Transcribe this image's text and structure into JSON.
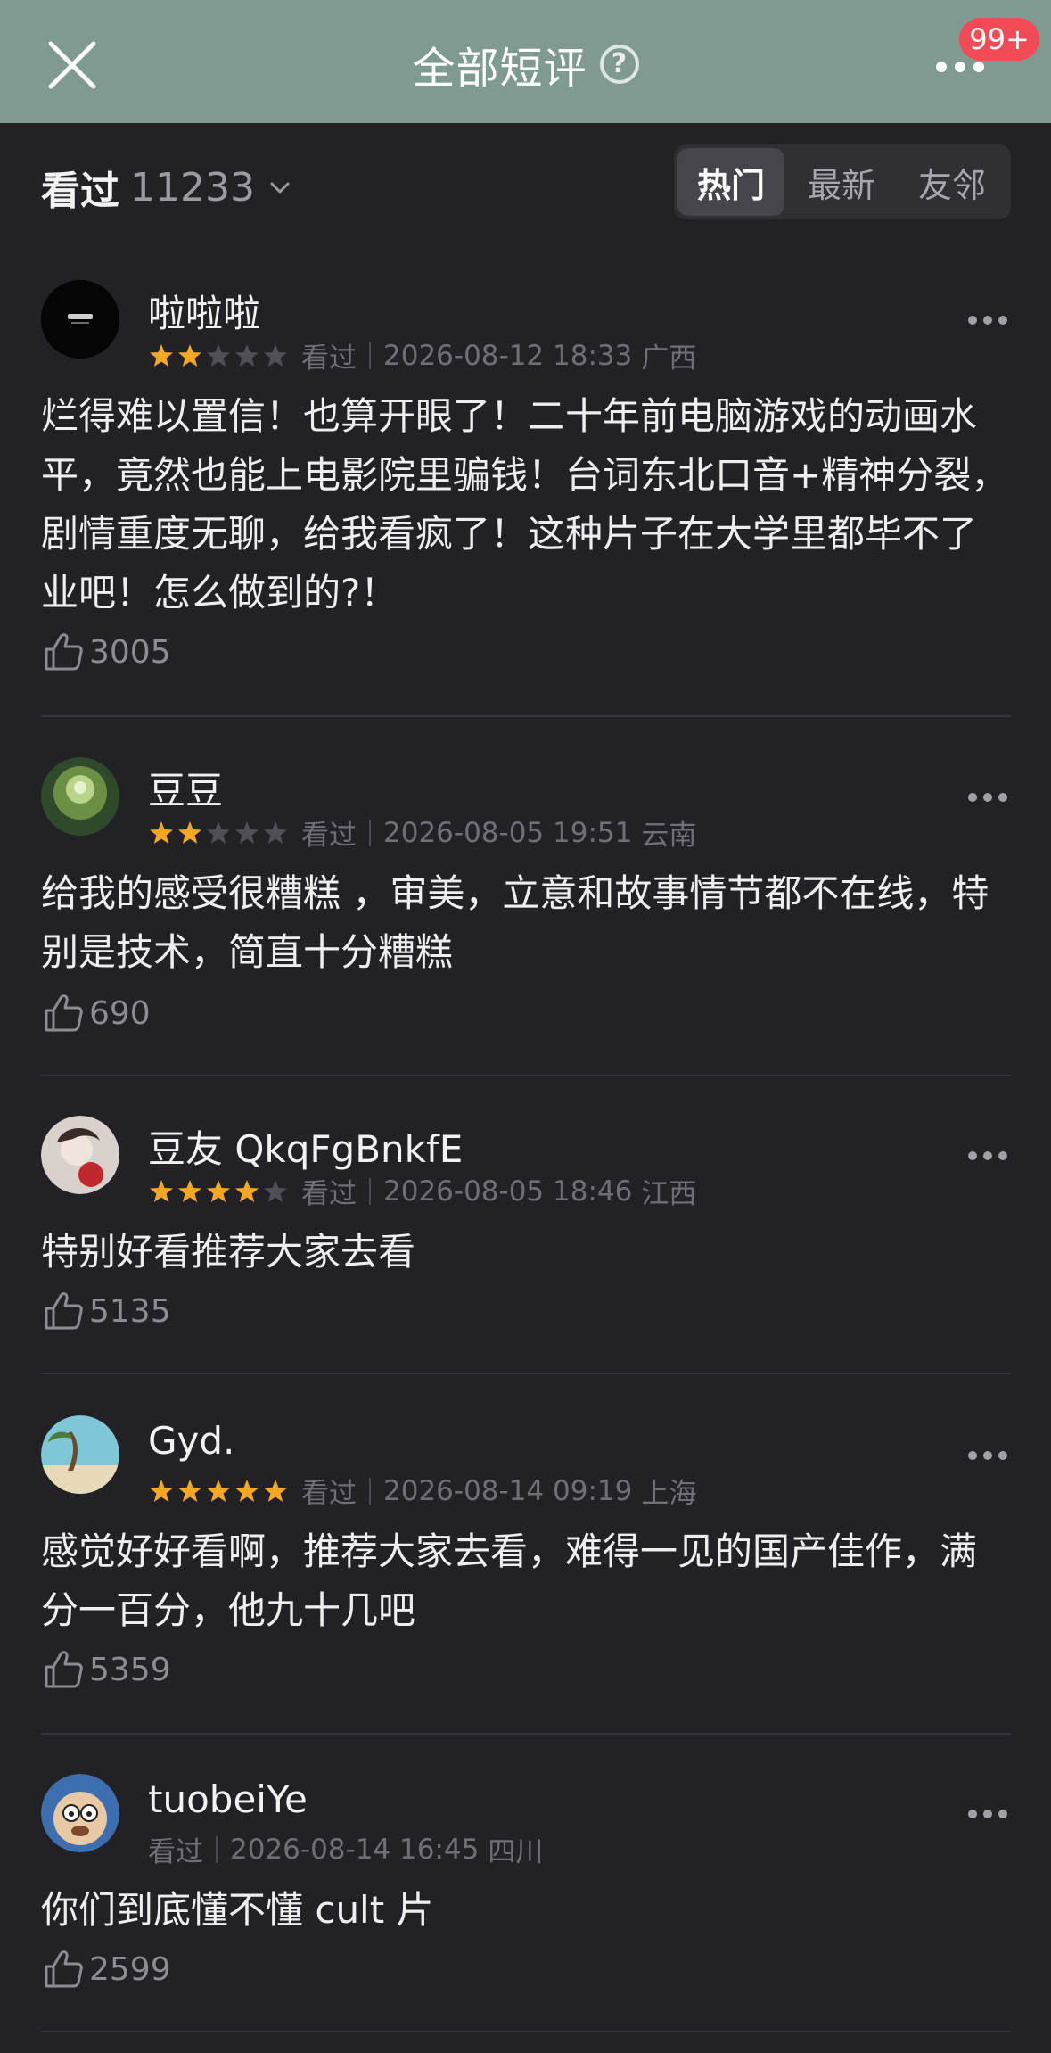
{
  "header": {
    "title": "全部短评",
    "help_icon": "question-circle-icon",
    "close_icon": "close-icon",
    "more_icon": "more-dots-icon",
    "badge": "99+",
    "background": "#7f9a90",
    "badge_color": "#f24b55"
  },
  "filter": {
    "watched_label": "看过",
    "watched_count": "11233",
    "tabs": [
      {
        "label": "热门",
        "active": true
      },
      {
        "label": "最新",
        "active": false
      },
      {
        "label": "友邻",
        "active": false
      }
    ]
  },
  "colors": {
    "background": "#222226",
    "star_active": "#f5a623",
    "star_inactive": "#4f4f55"
  },
  "reviews": [
    {
      "username": "啦啦啦",
      "rating": 2,
      "status": "看过",
      "datetime": "2026-08-12 18:33",
      "location": "广西",
      "text": "烂得难以置信！也算开眼了！二十年前电脑游戏的动画水平，竟然也能上电影院里骗钱！台词东北口音+精神分裂，剧情重度无聊，给我看疯了！这种片子在大学里都毕不了业吧！怎么做到的?！",
      "likes": "3005"
    },
    {
      "username": "豆豆",
      "rating": 2,
      "status": "看过",
      "datetime": "2026-08-05 19:51",
      "location": "云南",
      "text": "给我的感受很糟糕 ，审美，立意和故事情节都不在线，特别是技术，简直十分糟糕",
      "likes": "690"
    },
    {
      "username": "豆友 QkqFgBnkfE",
      "rating": 4,
      "status": "看过",
      "datetime": "2026-08-05 18:46",
      "location": "江西",
      "text": "特别好看推荐大家去看",
      "likes": "5135"
    },
    {
      "username": "Gyd.",
      "rating": 5,
      "status": "看过",
      "datetime": "2026-08-14 09:19",
      "location": "上海",
      "text": "感觉好好看啊，推荐大家去看，难得一见的国产佳作，满分一百分，他九十几吧",
      "likes": "5359"
    },
    {
      "username": "tuobeiYe",
      "rating": 0,
      "status": "看过",
      "datetime": "2026-08-14 16:45",
      "location": "四川",
      "text": "你们到底懂不懂 cult 片",
      "likes": "2599"
    }
  ]
}
